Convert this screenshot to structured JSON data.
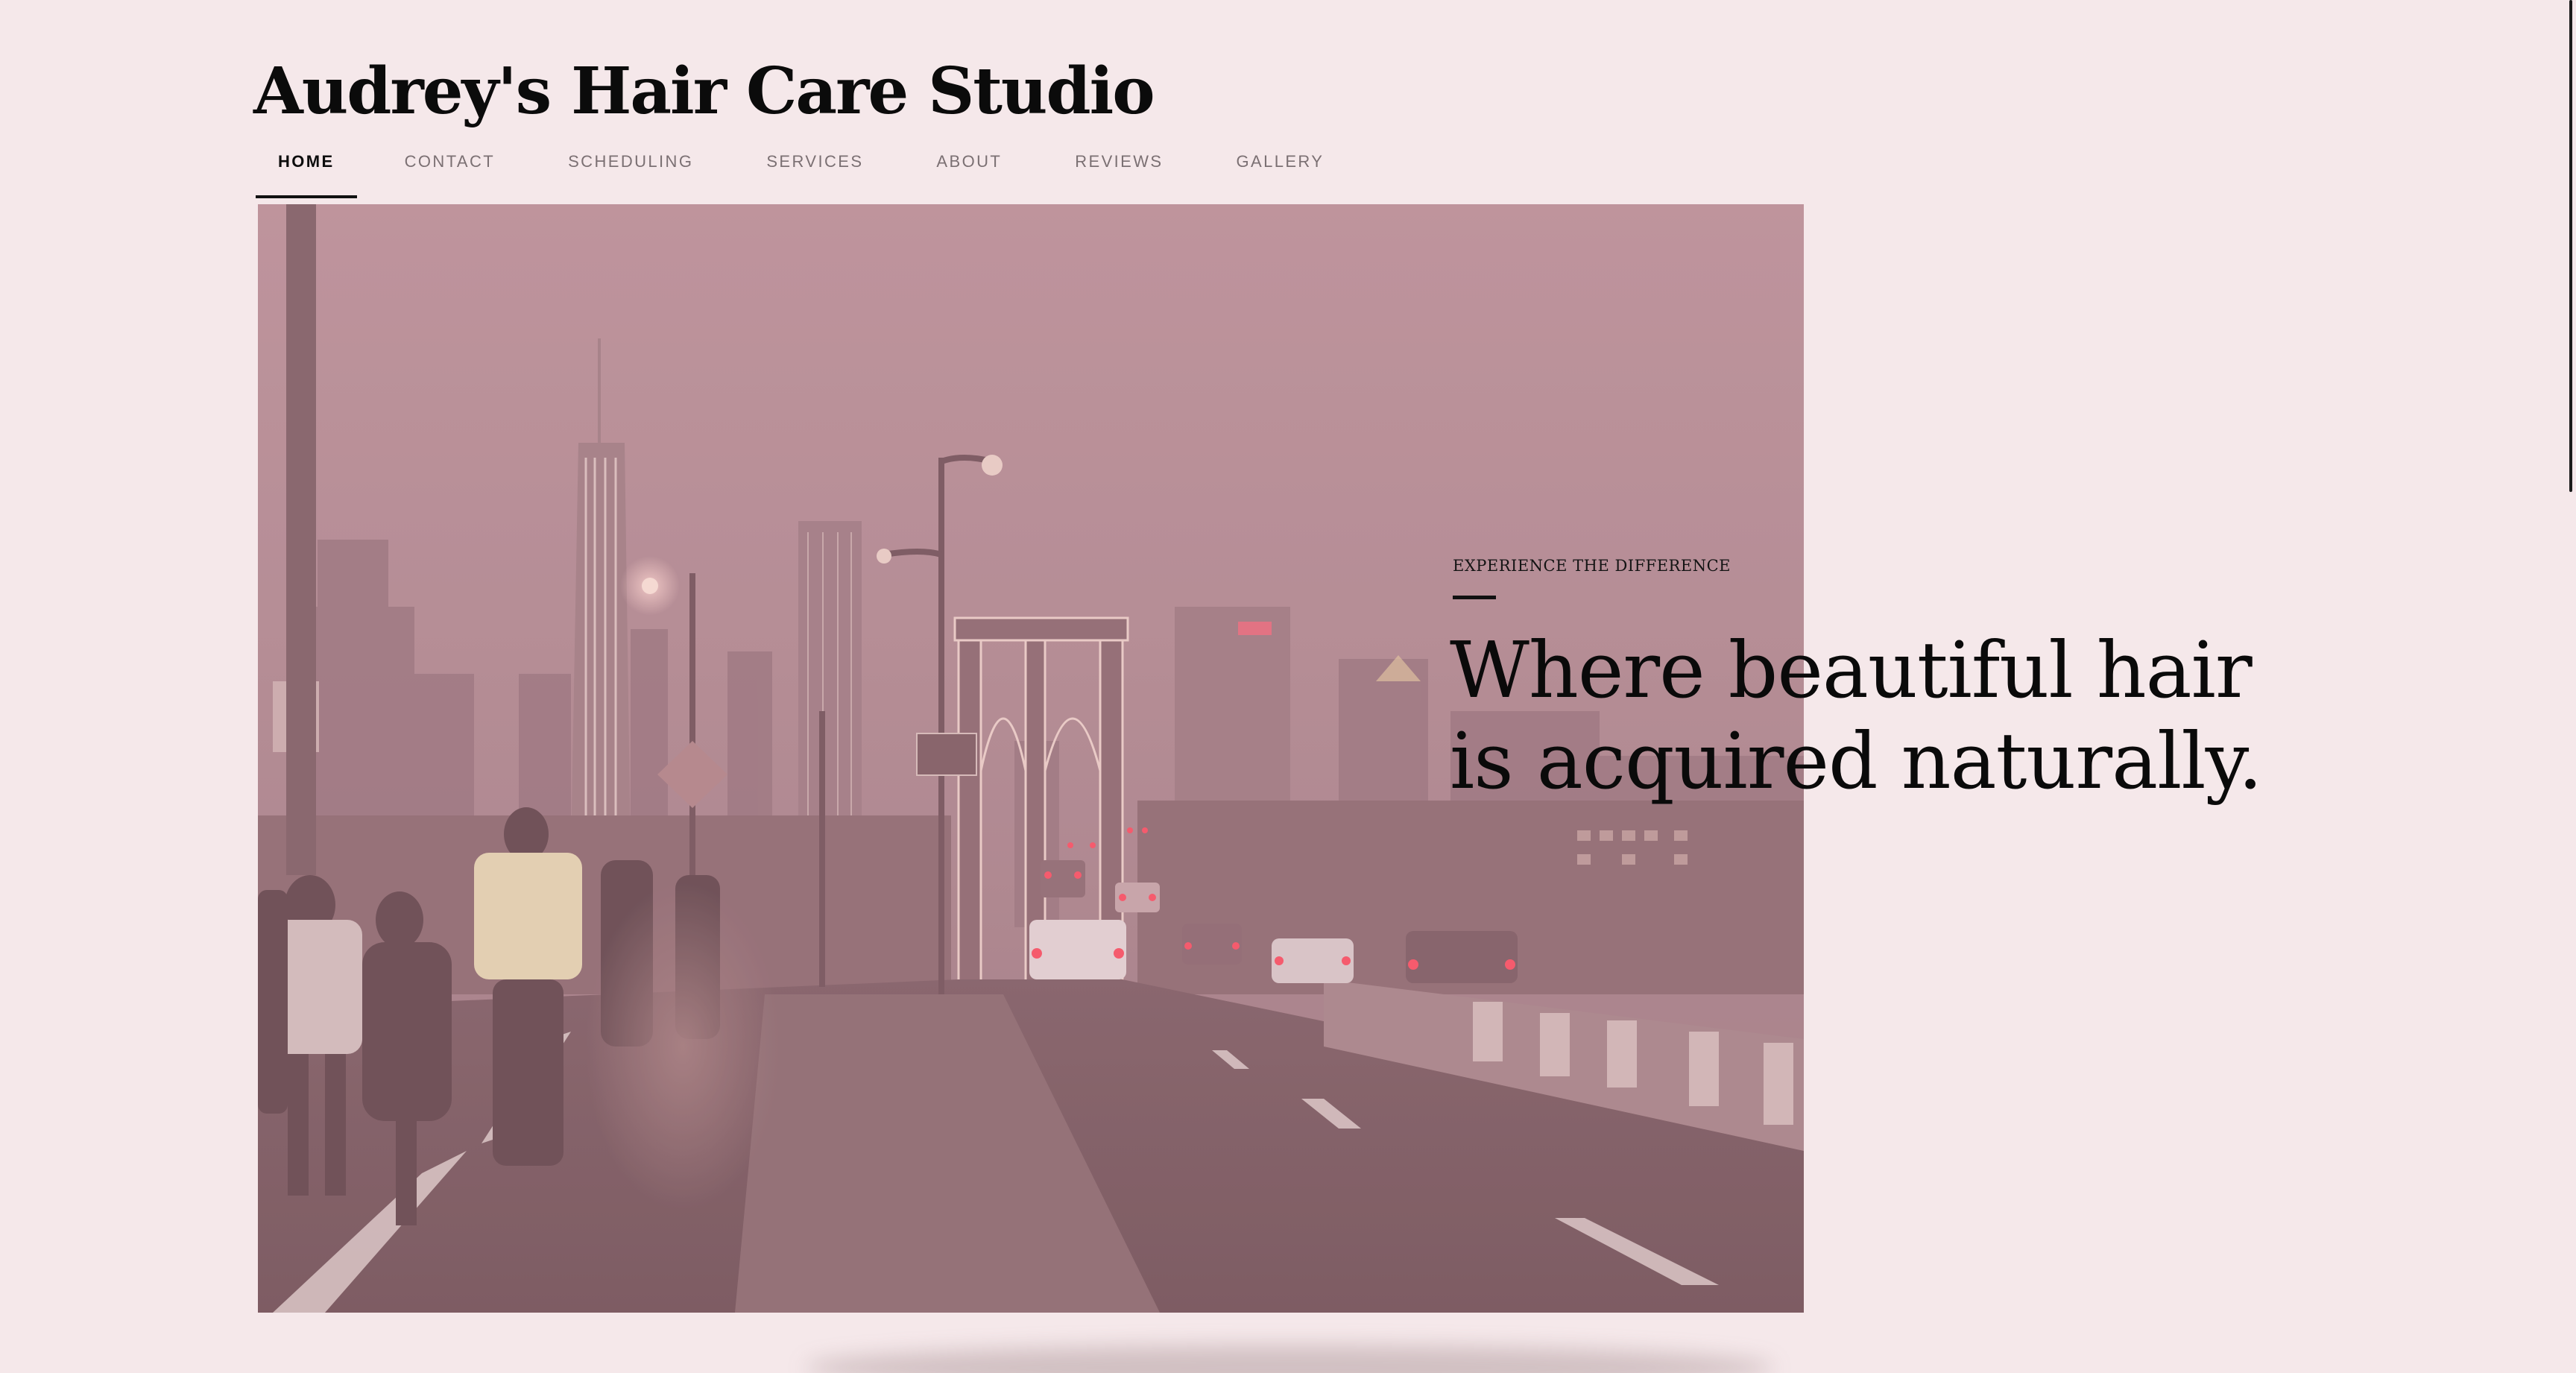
{
  "site": {
    "title": "Audrey's Hair Care Studio"
  },
  "nav": {
    "items": [
      {
        "label": "HOME",
        "active": true
      },
      {
        "label": "CONTACT",
        "active": false
      },
      {
        "label": "SCHEDULING",
        "active": false
      },
      {
        "label": "SERVICES",
        "active": false
      },
      {
        "label": "ABOUT",
        "active": false
      },
      {
        "label": "REVIEWS",
        "active": false
      },
      {
        "label": "GALLERY",
        "active": false
      }
    ]
  },
  "hero": {
    "kicker": "EXPERIENCE THE DIFFERENCE",
    "headline_line1": "Where beautiful hair",
    "headline_line2": "is acquired naturally."
  },
  "colors": {
    "background": "#f5e8ea",
    "text": "#0a0a0a",
    "nav_inactive": "#7b7073",
    "photo_tint": "#b48c94"
  }
}
